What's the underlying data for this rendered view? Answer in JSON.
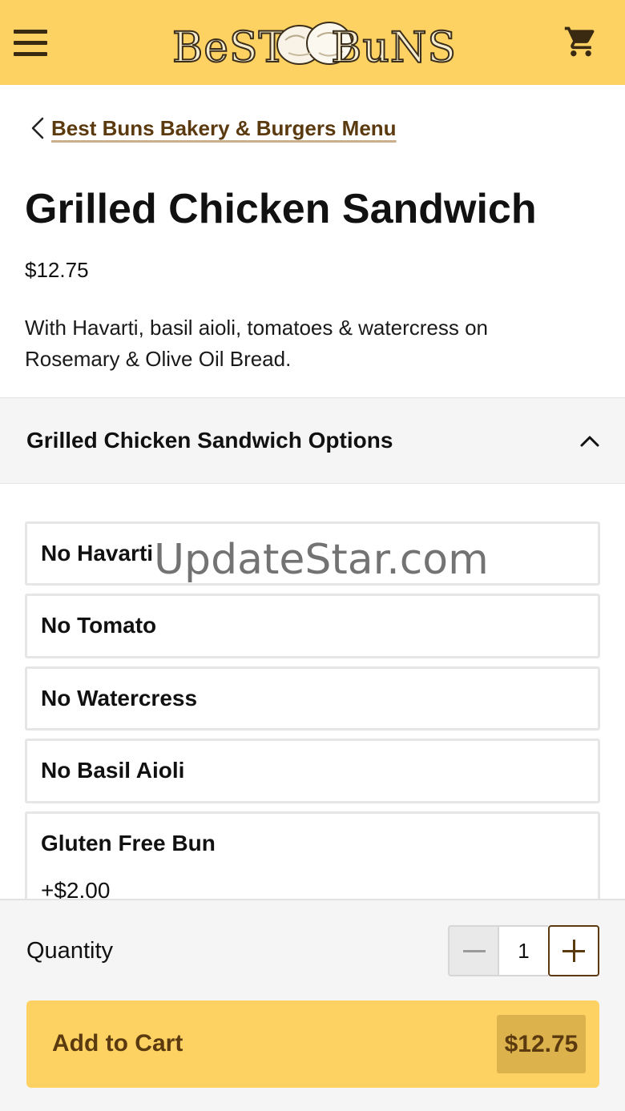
{
  "header": {
    "logo": {
      "left_text": "BeST",
      "right_text": "BuNS"
    },
    "menu_icon": "hamburger-menu-icon",
    "cart_icon": "shopping-cart-icon",
    "colors": {
      "background": "#fdd262",
      "icon": "#3a2a12"
    }
  },
  "breadcrumb": {
    "label": "Best Buns Bakery & Burgers Menu",
    "icon": "chevron-left-icon"
  },
  "product": {
    "title": "Grilled Chicken Sandwich",
    "price": "$12.75",
    "description": "With Havarti, basil aioli, tomatoes & watercress on Rosemary & Olive Oil Bread."
  },
  "options": {
    "header": "Grilled Chicken Sandwich Options",
    "expanded": true,
    "items": [
      {
        "label": "No Havarti",
        "price": ""
      },
      {
        "label": "No Tomato",
        "price": ""
      },
      {
        "label": "No Watercress",
        "price": ""
      },
      {
        "label": "No Basil Aioli",
        "price": ""
      },
      {
        "label": "Gluten Free Bun",
        "price": "+$2.00"
      }
    ]
  },
  "watermark": "UpdateStar.com",
  "cart": {
    "quantity_label": "Quantity",
    "quantity": "1",
    "add_label": "Add to Cart",
    "total": "$12.75",
    "colors": {
      "accent": "#fdd262",
      "text": "#5b3a10",
      "price_bg": "#dbb24c"
    }
  }
}
